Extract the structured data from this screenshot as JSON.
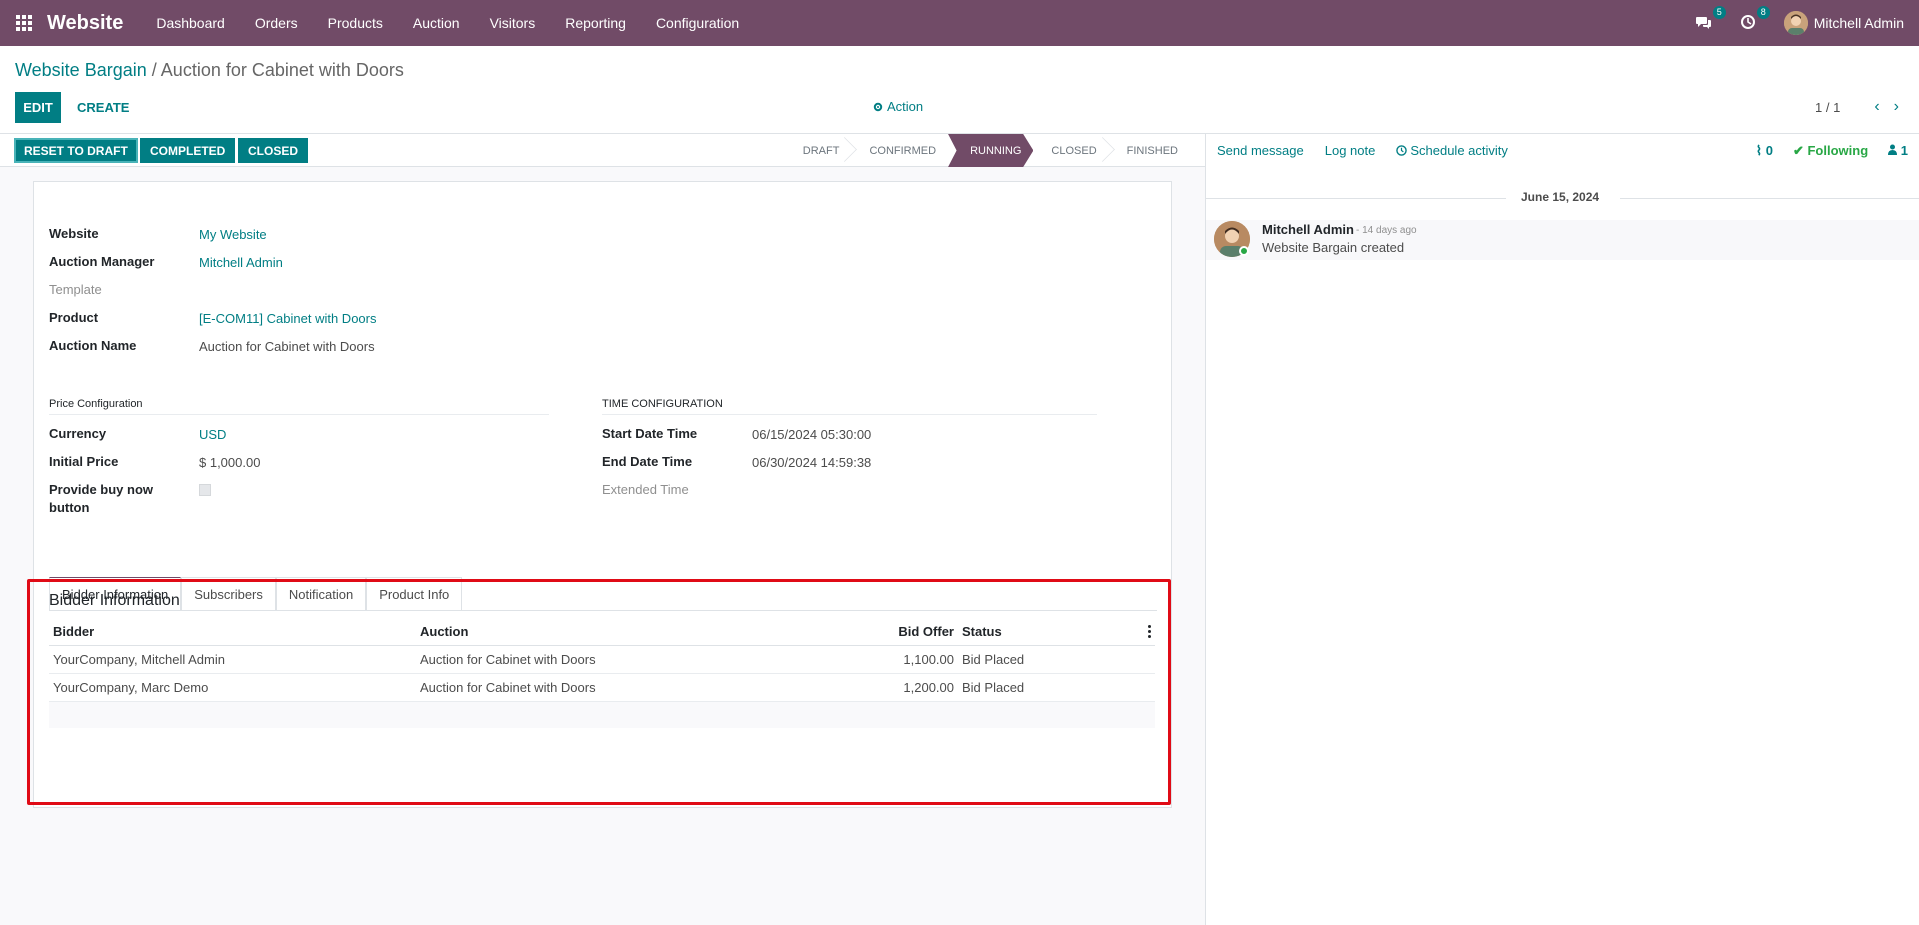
{
  "navbar": {
    "brand": "Website",
    "menu": [
      "Dashboard",
      "Orders",
      "Products",
      "Auction",
      "Visitors",
      "Reporting",
      "Configuration"
    ],
    "messages_count": "5",
    "activities_count": "8",
    "user_name": "Mitchell Admin",
    "bg_color": "#714b67"
  },
  "breadcrumb": {
    "parent": "Website Bargain",
    "separator": "/",
    "current": "Auction for Cabinet with Doors"
  },
  "controls": {
    "edit_label": "EDIT",
    "create_label": "CREATE",
    "action_label": "Action",
    "pager_value": "1 / 1"
  },
  "statusbar": {
    "buttons": [
      "RESET TO DRAFT",
      "COMPLETED",
      "CLOSED"
    ],
    "stages": [
      "DRAFT",
      "CONFIRMED",
      "RUNNING",
      "CLOSED",
      "FINISHED"
    ],
    "active_stage": "RUNNING"
  },
  "form": {
    "website_label": "Website",
    "website_value": "My Website",
    "manager_label": "Auction Manager",
    "manager_value": "Mitchell Admin",
    "template_label": "Template",
    "product_label": "Product",
    "product_value": "[E-COM11] Cabinet with Doors",
    "auction_name_label": "Auction Name",
    "auction_name_value": "Auction for Cabinet with Doors",
    "price_group_title": "Price Configuration",
    "currency_label": "Currency",
    "currency_value": "USD",
    "initial_price_label": "Initial Price",
    "initial_price_value": "$ 1,000.00",
    "buy_now_label_1": "Provide buy now",
    "buy_now_label_2": "button",
    "time_group_title": "TIME CONFIGURATION",
    "start_label": "Start Date Time",
    "start_value": "06/15/2024 05:30:00",
    "end_label": "End Date Time",
    "end_value": "06/30/2024 14:59:38",
    "extended_label": "Extended Time"
  },
  "tabs": [
    "Bidder Information",
    "Subscribers",
    "Notification",
    "Product Info"
  ],
  "bidder_section": {
    "title": "Bidder Information",
    "columns": [
      "Bidder",
      "Auction",
      "Bid Offer",
      "Status"
    ],
    "rows": [
      [
        "YourCompany, Mitchell Admin",
        "Auction for Cabinet with Doors",
        "1,100.00",
        "Bid Placed"
      ],
      [
        "YourCompany, Marc Demo",
        "Auction for Cabinet with Doors",
        "1,200.00",
        "Bid Placed"
      ]
    ]
  },
  "chatter": {
    "send_message": "Send message",
    "log_note": "Log note",
    "schedule_activity": "Schedule activity",
    "attachments_count": "0",
    "following_label": "Following",
    "followers_count": "1",
    "date_separator": "June 15, 2024",
    "message": {
      "author": "Mitchell Admin",
      "time": "- 14 days ago",
      "body": "Website Bargain created"
    }
  },
  "colors": {
    "primary": "#714b67",
    "accent": "#017e84",
    "highlight": "#e00b16",
    "following": "#28a745"
  }
}
